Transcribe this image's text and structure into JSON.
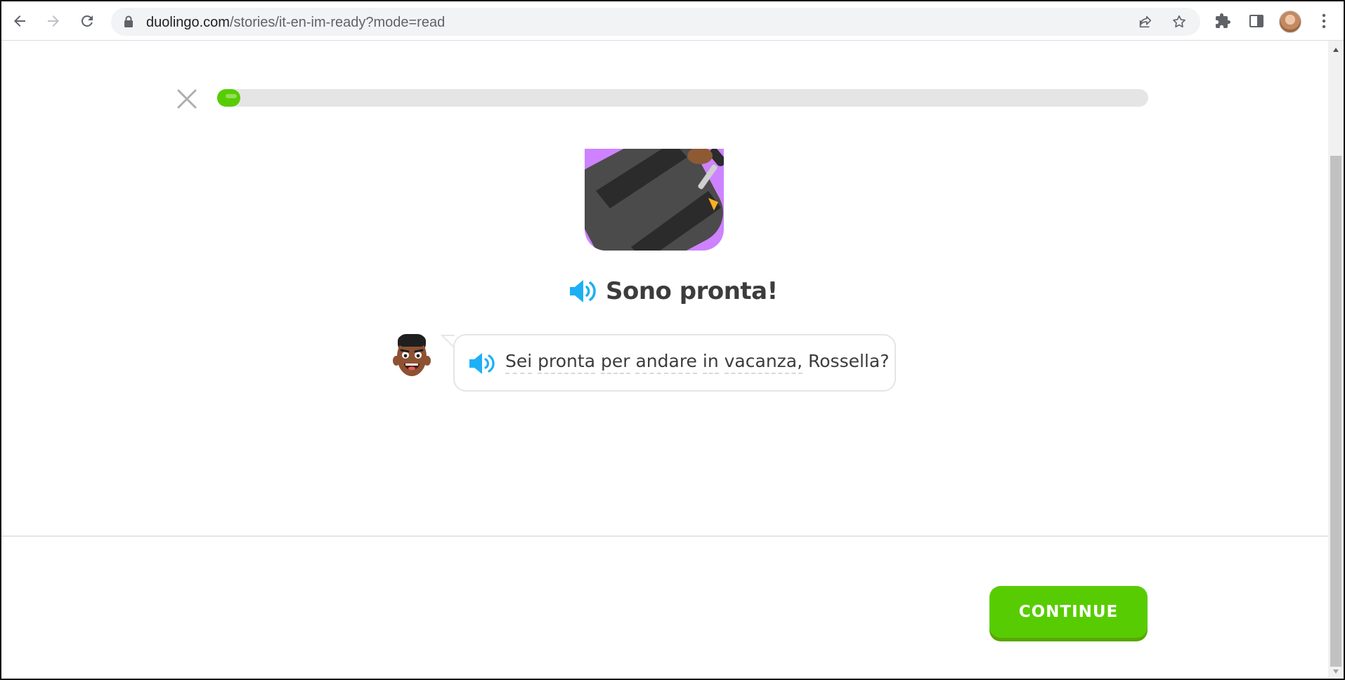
{
  "browser": {
    "url_domain": "duolingo.com",
    "url_path": "/stories/it-en-im-ready?mode=read"
  },
  "lesson": {
    "progress_fraction": 0.025,
    "title": "Sono pronta!",
    "line_words": [
      "Sei",
      "pronta",
      "per",
      "andare",
      "in",
      "vacanza,",
      "Rossella?"
    ],
    "continue_label": "CONTINUE"
  },
  "colors": {
    "accent_green": "#58cc02",
    "speaker_blue": "#1cb0f6",
    "illustration_purple": "#ce82ff"
  }
}
